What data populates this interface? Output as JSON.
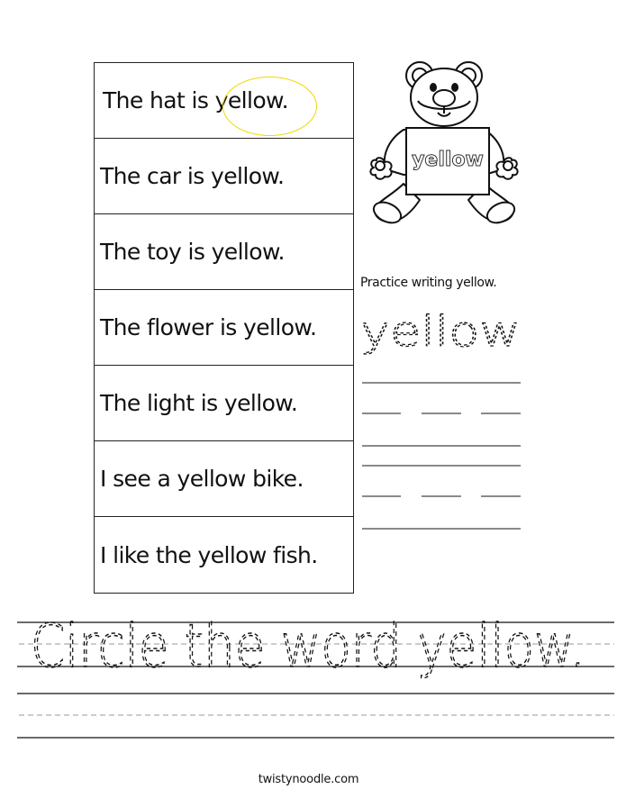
{
  "worksheet": {
    "target_word": "yellow",
    "sentences": [
      {
        "text": "The hat is yellow.",
        "circled_example": true
      },
      {
        "text": "The car is yellow.",
        "circled_example": false
      },
      {
        "text": "The toy is yellow.",
        "circled_example": false
      },
      {
        "text": "The flower is yellow.",
        "circled_example": false
      },
      {
        "text": "The light is yellow.",
        "circled_example": false
      },
      {
        "text": "I see a yellow bike.",
        "circled_example": false
      },
      {
        "text": "I like the yellow fish.",
        "circled_example": false
      }
    ],
    "circle_color": "#f0d800",
    "illustration": {
      "icon": "teddy-bear-holding-sign-icon",
      "sign_text": "yellow"
    },
    "practice": {
      "label": "Practice writing yellow.",
      "trace_word": "yellow"
    },
    "title": {
      "trace_text": "Circle the word yellow."
    }
  },
  "footer": {
    "site": "twistynoodle.com"
  }
}
